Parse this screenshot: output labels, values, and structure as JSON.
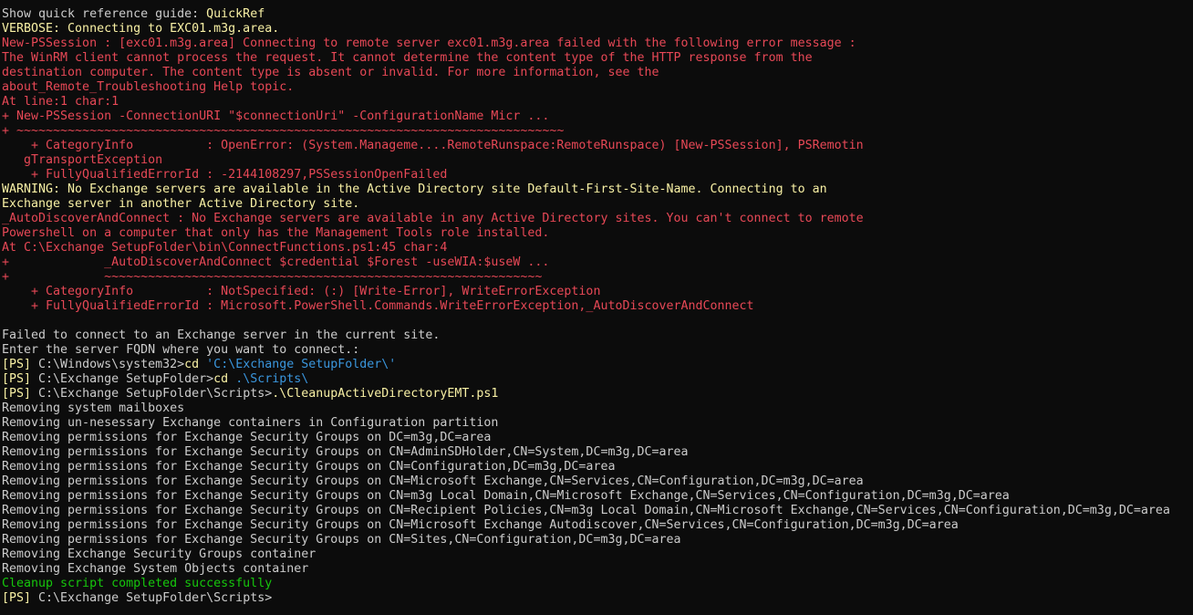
{
  "terminal": {
    "lines": [
      {
        "type": "default",
        "text": "Show quick reference guide: QuickRef",
        "highlight": "QuickRef"
      },
      {
        "type": "verbose",
        "text": "VERBOSE: Connecting to EXC01.m3g.area."
      },
      {
        "type": "err",
        "text": "New-PSSession : [exc01.m3g.area] Connecting to remote server exc01.m3g.area failed with the following error message :"
      },
      {
        "type": "err",
        "text": "The WinRM client cannot process the request. It cannot determine the content type of the HTTP response from the"
      },
      {
        "type": "err",
        "text": "destination computer. The content type is absent or invalid. For more information, see the"
      },
      {
        "type": "err",
        "text": "about_Remote_Troubleshooting Help topic."
      },
      {
        "type": "err",
        "text": "At line:1 char:1"
      },
      {
        "type": "err",
        "text": "+ New-PSSession -ConnectionURI \"$connectionUri\" -ConfigurationName Micr ..."
      },
      {
        "type": "err",
        "text": "+ ~~~~~~~~~~~~~~~~~~~~~~~~~~~~~~~~~~~~~~~~~~~~~~~~~~~~~~~~~~~~~~~~~~~~~~~~~~~"
      },
      {
        "type": "err",
        "text": "    + CategoryInfo          : OpenError: (System.Manageme....RemoteRunspace:RemoteRunspace) [New-PSSession], PSRemotin"
      },
      {
        "type": "err",
        "text": "   gTransportException"
      },
      {
        "type": "err",
        "text": "    + FullyQualifiedErrorId : -2144108297,PSSessionOpenFailed"
      },
      {
        "type": "warn",
        "text": "WARNING: No Exchange servers are available in the Active Directory site Default-First-Site-Name. Connecting to an"
      },
      {
        "type": "warn",
        "text": "Exchange server in another Active Directory site."
      },
      {
        "type": "err",
        "text": "_AutoDiscoverAndConnect : No Exchange servers are available in any Active Directory sites. You can't connect to remote"
      },
      {
        "type": "err",
        "text": "Powershell on a computer that only has the Management Tools role installed."
      },
      {
        "type": "err",
        "text": "At C:\\Exchange SetupFolder\\bin\\ConnectFunctions.ps1:45 char:4"
      },
      {
        "type": "err",
        "text": "+             _AutoDiscoverAndConnect $credential $Forest -useWIA:$useW ..."
      },
      {
        "type": "err",
        "text": "+             ~~~~~~~~~~~~~~~~~~~~~~~~~~~~~~~~~~~~~~~~~~~~~~~~~~~~~~~~~~~~"
      },
      {
        "type": "err",
        "text": "    + CategoryInfo          : NotSpecified: (:) [Write-Error], WriteErrorException"
      },
      {
        "type": "err",
        "text": "    + FullyQualifiedErrorId : Microsoft.PowerShell.Commands.WriteErrorException,_AutoDiscoverAndConnect"
      },
      {
        "type": "default",
        "text": " "
      },
      {
        "type": "default",
        "text": "Failed to connect to an Exchange server in the current site."
      },
      {
        "type": "default",
        "text": "Enter the server FQDN where you want to connect.:"
      },
      {
        "type": "prompt",
        "prompt_bracket": "[PS]",
        "prompt_path": " C:\\Windows\\system32>",
        "command": "cd",
        "argument": " 'C:\\Exchange SetupFolder\\'"
      },
      {
        "type": "prompt",
        "prompt_bracket": "[PS]",
        "prompt_path": " C:\\Exchange SetupFolder>",
        "command": "cd",
        "argument": " .\\Scripts\\"
      },
      {
        "type": "prompt",
        "prompt_bracket": "[PS]",
        "prompt_path": " C:\\Exchange SetupFolder\\Scripts>",
        "command": ".\\CleanupActiveDirectoryEMT.ps1",
        "argument": ""
      },
      {
        "type": "default",
        "text": "Removing system mailboxes"
      },
      {
        "type": "default",
        "text": "Removing un-nesessary Exchange containers in Configuration partition"
      },
      {
        "type": "default",
        "text": "Removing permissions for Exchange Security Groups on DC=m3g,DC=area"
      },
      {
        "type": "default",
        "text": "Removing permissions for Exchange Security Groups on CN=AdminSDHolder,CN=System,DC=m3g,DC=area"
      },
      {
        "type": "default",
        "text": "Removing permissions for Exchange Security Groups on CN=Configuration,DC=m3g,DC=area"
      },
      {
        "type": "default",
        "text": "Removing permissions for Exchange Security Groups on CN=Microsoft Exchange,CN=Services,CN=Configuration,DC=m3g,DC=area"
      },
      {
        "type": "default",
        "text": "Removing permissions for Exchange Security Groups on CN=m3g Local Domain,CN=Microsoft Exchange,CN=Services,CN=Configuration,DC=m3g,DC=area"
      },
      {
        "type": "default",
        "text": "Removing permissions for Exchange Security Groups on CN=Recipient Policies,CN=m3g Local Domain,CN=Microsoft Exchange,CN=Services,CN=Configuration,DC=m3g,DC=area"
      },
      {
        "type": "default",
        "text": "Removing permissions for Exchange Security Groups on CN=Microsoft Exchange Autodiscover,CN=Services,CN=Configuration,DC=m3g,DC=area"
      },
      {
        "type": "default",
        "text": "Removing permissions for Exchange Security Groups on CN=Sites,CN=Configuration,DC=m3g,DC=area"
      },
      {
        "type": "default",
        "text": "Removing Exchange Security Groups container"
      },
      {
        "type": "default",
        "text": "Removing Exchange System Objects container"
      },
      {
        "type": "success",
        "text": "Cleanup script completed successfully"
      },
      {
        "type": "prompt",
        "prompt_bracket": "[PS]",
        "prompt_path": " C:\\Exchange SetupFolder\\Scripts>",
        "command": "",
        "argument": ""
      }
    ]
  },
  "colors": {
    "background": "#0c0c0c",
    "default_text": "#cccccc",
    "error": "#e74856",
    "warning": "#f9f1a5",
    "success": "#16c60c",
    "string_argument": "#3a96dd"
  }
}
